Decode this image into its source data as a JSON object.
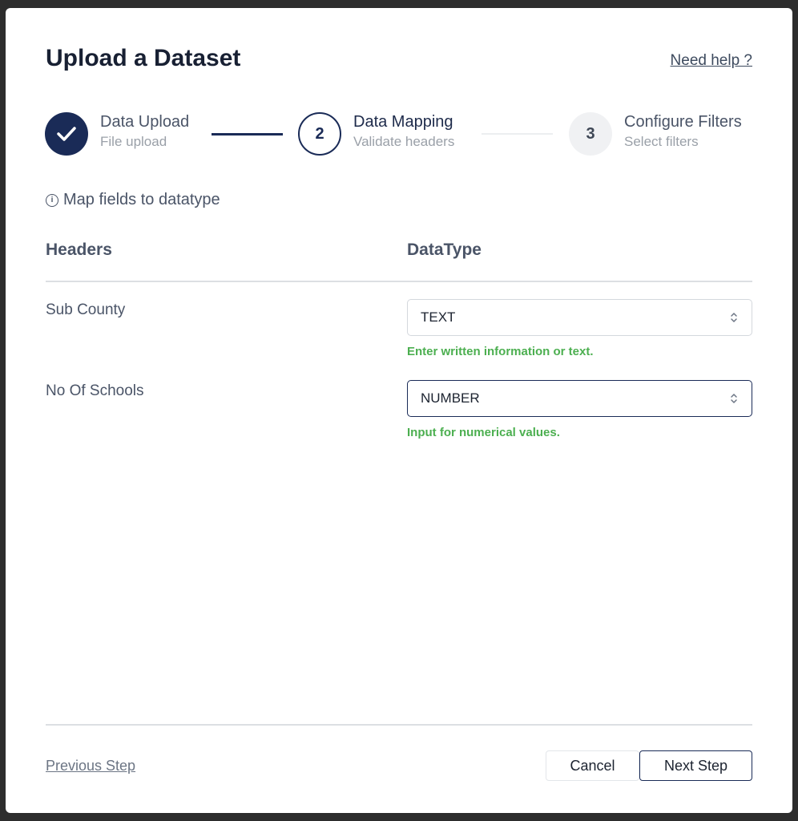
{
  "dialog": {
    "title": "Upload a Dataset",
    "help_link": "Need help ?"
  },
  "stepper": {
    "steps": [
      {
        "number": "1",
        "title": "Data Upload",
        "subtitle": "File upload",
        "state": "completed"
      },
      {
        "number": "2",
        "title": "Data Mapping",
        "subtitle": "Validate headers",
        "state": "active"
      },
      {
        "number": "3",
        "title": "Configure Filters",
        "subtitle": "Select filters",
        "state": "pending"
      }
    ]
  },
  "mapping": {
    "info_text": "Map fields to datatype",
    "columns": [
      "Headers",
      "DataType"
    ],
    "rows": [
      {
        "header": "Sub County",
        "datatype": "TEXT",
        "hint": "Enter written information or text."
      },
      {
        "header": "No Of Schools",
        "datatype": "NUMBER",
        "hint": "Input for numerical values."
      }
    ]
  },
  "footer": {
    "previous_label": "Previous Step",
    "cancel_label": "Cancel",
    "next_label": "Next Step"
  },
  "colors": {
    "primary": "#1a2b57",
    "hint_green": "#4caf50",
    "text": "#4a5467"
  },
  "icons": {
    "completed": "check-icon",
    "info": "info-icon",
    "select": "chevron-up-down-icon"
  }
}
